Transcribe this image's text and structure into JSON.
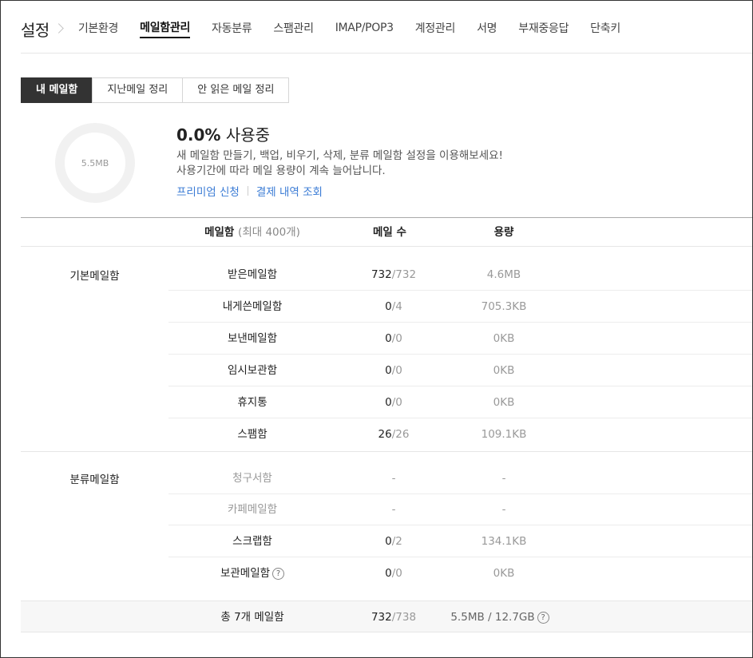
{
  "nav": {
    "title": "설정",
    "tabs": [
      {
        "label": "기본환경",
        "active": false
      },
      {
        "label": "메일함관리",
        "active": true
      },
      {
        "label": "자동분류",
        "active": false
      },
      {
        "label": "스팸관리",
        "active": false
      },
      {
        "label": "IMAP/POP3",
        "active": false
      },
      {
        "label": "계정관리",
        "active": false
      },
      {
        "label": "서명",
        "active": false
      },
      {
        "label": "부재중응답",
        "active": false
      },
      {
        "label": "단축키",
        "active": false
      }
    ]
  },
  "subtabs": [
    {
      "label": "내 메일함",
      "active": true
    },
    {
      "label": "지난메일 정리",
      "active": false
    },
    {
      "label": "안 읽은 메일 정리",
      "active": false
    }
  ],
  "usage": {
    "donut_label": "5.5MB",
    "percent": "0.0%",
    "status": "사용중",
    "desc_line1": "새 메일함 만들기, 백업, 비우기, 삭제, 분류 메일함 설정을 이용해보세요!",
    "desc_line2": "사용기간에 따라 메일 용량이 계속 늘어납니다.",
    "link_premium": "프리미엄 신청",
    "link_payment": "결제 내역 조회"
  },
  "table": {
    "header": {
      "mailbox": "메일함",
      "mailbox_sub": "(최대 400개)",
      "count": "메일 수",
      "size": "용량"
    },
    "groups": [
      {
        "label": "기본메일함",
        "rows": [
          {
            "name": "받은메일함",
            "count": "732",
            "total": "/732",
            "size": "4.6MB"
          },
          {
            "name": "내게쓴메일함",
            "count": "0",
            "total": "/4",
            "size": "705.3KB"
          },
          {
            "name": "보낸메일함",
            "count": "0",
            "total": "/0",
            "size": "0KB"
          },
          {
            "name": "임시보관함",
            "count": "0",
            "total": "/0",
            "size": "0KB"
          },
          {
            "name": "휴지통",
            "count": "0",
            "total": "/0",
            "size": "0KB"
          },
          {
            "name": "스팸함",
            "count": "26",
            "total": "/26",
            "size": "109.1KB"
          }
        ]
      },
      {
        "label": "분류메일함",
        "rows": [
          {
            "name": "청구서함",
            "count": "-",
            "size": "-"
          },
          {
            "name": "카페메일함",
            "count": "-",
            "size": "-"
          },
          {
            "name": "스크랩함",
            "count": "0",
            "total": "/2",
            "size": "134.1KB"
          },
          {
            "name": "보관메일함",
            "count": "0",
            "total": "/0",
            "size": "0KB"
          }
        ]
      }
    ],
    "total": {
      "label": "총 7개 메일함",
      "count": "732",
      "count_total": "/738",
      "size": "5.5MB / 12.7GB"
    }
  },
  "icons": {
    "help": "?"
  }
}
